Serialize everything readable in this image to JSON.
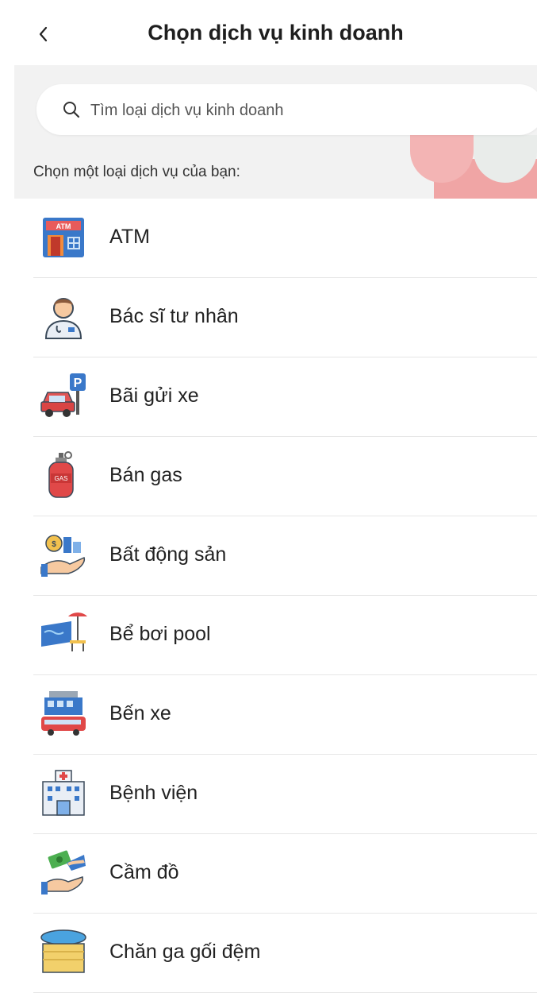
{
  "header": {
    "title": "Chọn dịch vụ kinh doanh"
  },
  "search": {
    "placeholder": "Tìm loại dịch vụ kinh doanh",
    "value": ""
  },
  "choose_label": "Chọn một loại dịch vụ của bạn:",
  "services": [
    {
      "label": "ATM",
      "icon": "atm-icon"
    },
    {
      "label": "Bác sĩ tư nhân",
      "icon": "doctor-icon"
    },
    {
      "label": "Bãi gửi xe",
      "icon": "parking-icon"
    },
    {
      "label": "Bán gas",
      "icon": "gas-cylinder-icon"
    },
    {
      "label": "Bất động sản",
      "icon": "real-estate-icon"
    },
    {
      "label": "Bể bơi pool",
      "icon": "pool-icon"
    },
    {
      "label": "Bến xe",
      "icon": "bus-station-icon"
    },
    {
      "label": "Bệnh viện",
      "icon": "hospital-icon"
    },
    {
      "label": "Cầm đồ",
      "icon": "pawn-icon"
    },
    {
      "label": "Chăn ga gối đệm",
      "icon": "bedding-icon"
    }
  ],
  "colors": {
    "search_bg": "#f2f2f2",
    "accent_pink": "#f0a5a5",
    "divider": "#e6e6e6"
  }
}
